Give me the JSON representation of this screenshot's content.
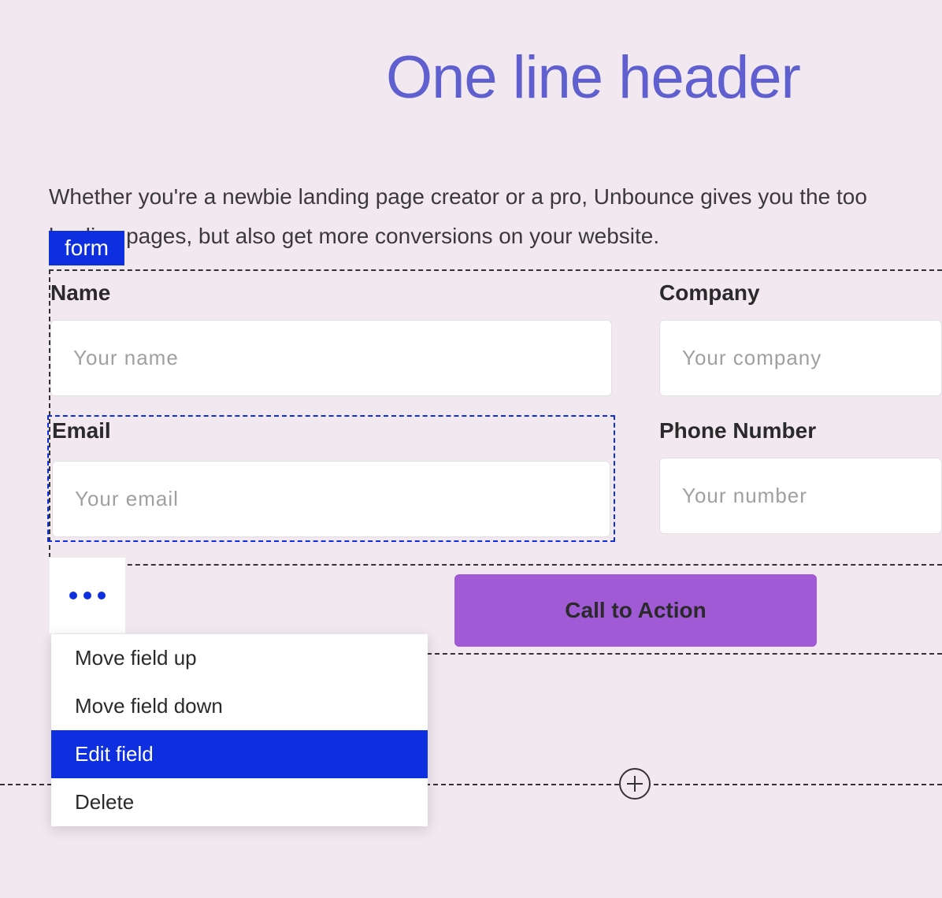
{
  "header": {
    "title": "One line header"
  },
  "subheader": {
    "line1": "Whether you're a newbie landing page creator or a pro, Unbounce gives you the too",
    "line2": "landing pages, but also get more conversions on your website."
  },
  "form": {
    "tag": "form",
    "fields": {
      "name": {
        "label": "Name",
        "placeholder": "Your name"
      },
      "company": {
        "label": "Company",
        "placeholder": "Your company"
      },
      "email": {
        "label": "Email",
        "placeholder": "Your email"
      },
      "phone": {
        "label": "Phone Number",
        "placeholder": "Your number"
      }
    },
    "cta": "Call to Action"
  },
  "contextMenu": {
    "items": [
      "Move field up",
      "Move field down",
      "Edit field",
      "Delete"
    ],
    "activeIndex": 2
  }
}
